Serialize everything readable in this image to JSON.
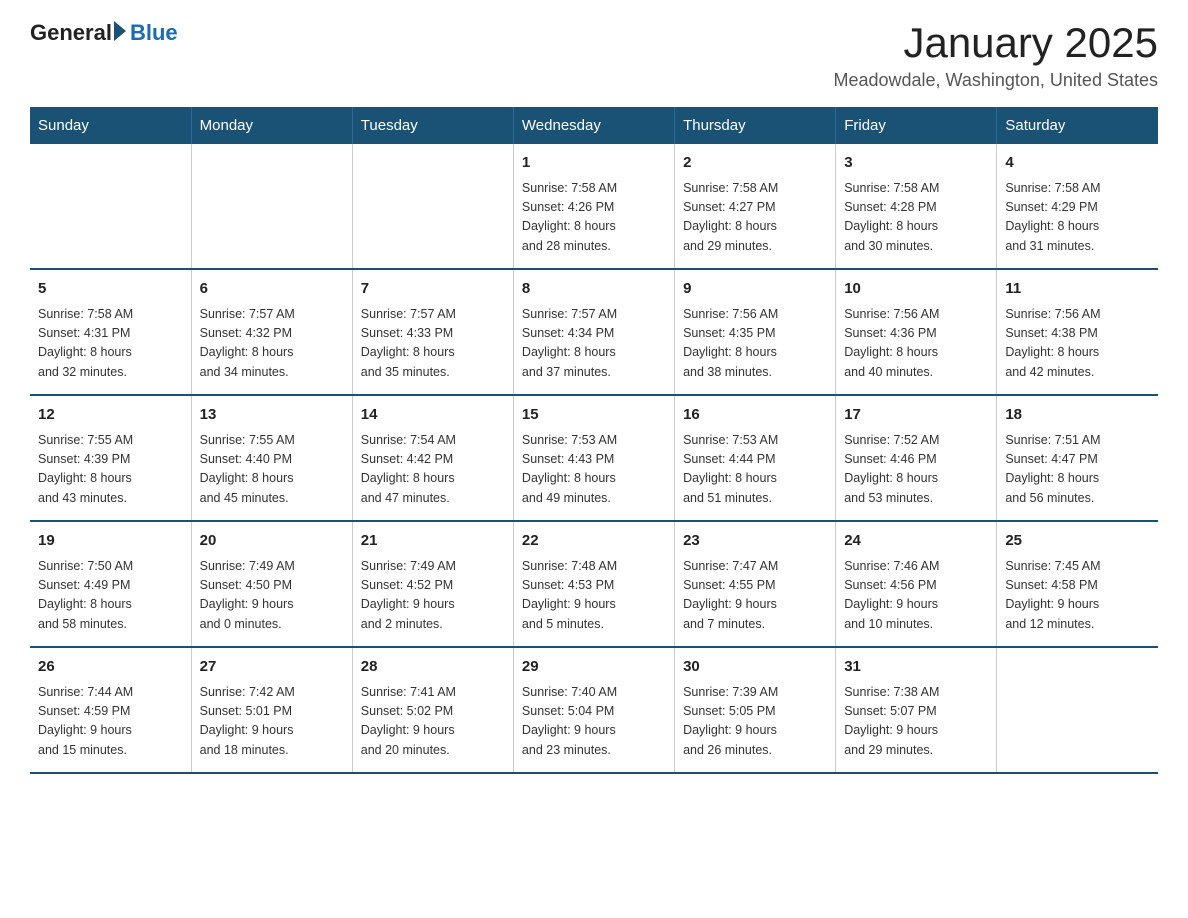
{
  "header": {
    "logo_general": "General",
    "logo_blue": "Blue",
    "title": "January 2025",
    "subtitle": "Meadowdale, Washington, United States"
  },
  "days_of_week": [
    "Sunday",
    "Monday",
    "Tuesday",
    "Wednesday",
    "Thursday",
    "Friday",
    "Saturday"
  ],
  "weeks": [
    [
      {
        "num": "",
        "info": ""
      },
      {
        "num": "",
        "info": ""
      },
      {
        "num": "",
        "info": ""
      },
      {
        "num": "1",
        "info": "Sunrise: 7:58 AM\nSunset: 4:26 PM\nDaylight: 8 hours\nand 28 minutes."
      },
      {
        "num": "2",
        "info": "Sunrise: 7:58 AM\nSunset: 4:27 PM\nDaylight: 8 hours\nand 29 minutes."
      },
      {
        "num": "3",
        "info": "Sunrise: 7:58 AM\nSunset: 4:28 PM\nDaylight: 8 hours\nand 30 minutes."
      },
      {
        "num": "4",
        "info": "Sunrise: 7:58 AM\nSunset: 4:29 PM\nDaylight: 8 hours\nand 31 minutes."
      }
    ],
    [
      {
        "num": "5",
        "info": "Sunrise: 7:58 AM\nSunset: 4:31 PM\nDaylight: 8 hours\nand 32 minutes."
      },
      {
        "num": "6",
        "info": "Sunrise: 7:57 AM\nSunset: 4:32 PM\nDaylight: 8 hours\nand 34 minutes."
      },
      {
        "num": "7",
        "info": "Sunrise: 7:57 AM\nSunset: 4:33 PM\nDaylight: 8 hours\nand 35 minutes."
      },
      {
        "num": "8",
        "info": "Sunrise: 7:57 AM\nSunset: 4:34 PM\nDaylight: 8 hours\nand 37 minutes."
      },
      {
        "num": "9",
        "info": "Sunrise: 7:56 AM\nSunset: 4:35 PM\nDaylight: 8 hours\nand 38 minutes."
      },
      {
        "num": "10",
        "info": "Sunrise: 7:56 AM\nSunset: 4:36 PM\nDaylight: 8 hours\nand 40 minutes."
      },
      {
        "num": "11",
        "info": "Sunrise: 7:56 AM\nSunset: 4:38 PM\nDaylight: 8 hours\nand 42 minutes."
      }
    ],
    [
      {
        "num": "12",
        "info": "Sunrise: 7:55 AM\nSunset: 4:39 PM\nDaylight: 8 hours\nand 43 minutes."
      },
      {
        "num": "13",
        "info": "Sunrise: 7:55 AM\nSunset: 4:40 PM\nDaylight: 8 hours\nand 45 minutes."
      },
      {
        "num": "14",
        "info": "Sunrise: 7:54 AM\nSunset: 4:42 PM\nDaylight: 8 hours\nand 47 minutes."
      },
      {
        "num": "15",
        "info": "Sunrise: 7:53 AM\nSunset: 4:43 PM\nDaylight: 8 hours\nand 49 minutes."
      },
      {
        "num": "16",
        "info": "Sunrise: 7:53 AM\nSunset: 4:44 PM\nDaylight: 8 hours\nand 51 minutes."
      },
      {
        "num": "17",
        "info": "Sunrise: 7:52 AM\nSunset: 4:46 PM\nDaylight: 8 hours\nand 53 minutes."
      },
      {
        "num": "18",
        "info": "Sunrise: 7:51 AM\nSunset: 4:47 PM\nDaylight: 8 hours\nand 56 minutes."
      }
    ],
    [
      {
        "num": "19",
        "info": "Sunrise: 7:50 AM\nSunset: 4:49 PM\nDaylight: 8 hours\nand 58 minutes."
      },
      {
        "num": "20",
        "info": "Sunrise: 7:49 AM\nSunset: 4:50 PM\nDaylight: 9 hours\nand 0 minutes."
      },
      {
        "num": "21",
        "info": "Sunrise: 7:49 AM\nSunset: 4:52 PM\nDaylight: 9 hours\nand 2 minutes."
      },
      {
        "num": "22",
        "info": "Sunrise: 7:48 AM\nSunset: 4:53 PM\nDaylight: 9 hours\nand 5 minutes."
      },
      {
        "num": "23",
        "info": "Sunrise: 7:47 AM\nSunset: 4:55 PM\nDaylight: 9 hours\nand 7 minutes."
      },
      {
        "num": "24",
        "info": "Sunrise: 7:46 AM\nSunset: 4:56 PM\nDaylight: 9 hours\nand 10 minutes."
      },
      {
        "num": "25",
        "info": "Sunrise: 7:45 AM\nSunset: 4:58 PM\nDaylight: 9 hours\nand 12 minutes."
      }
    ],
    [
      {
        "num": "26",
        "info": "Sunrise: 7:44 AM\nSunset: 4:59 PM\nDaylight: 9 hours\nand 15 minutes."
      },
      {
        "num": "27",
        "info": "Sunrise: 7:42 AM\nSunset: 5:01 PM\nDaylight: 9 hours\nand 18 minutes."
      },
      {
        "num": "28",
        "info": "Sunrise: 7:41 AM\nSunset: 5:02 PM\nDaylight: 9 hours\nand 20 minutes."
      },
      {
        "num": "29",
        "info": "Sunrise: 7:40 AM\nSunset: 5:04 PM\nDaylight: 9 hours\nand 23 minutes."
      },
      {
        "num": "30",
        "info": "Sunrise: 7:39 AM\nSunset: 5:05 PM\nDaylight: 9 hours\nand 26 minutes."
      },
      {
        "num": "31",
        "info": "Sunrise: 7:38 AM\nSunset: 5:07 PM\nDaylight: 9 hours\nand 29 minutes."
      },
      {
        "num": "",
        "info": ""
      }
    ]
  ]
}
